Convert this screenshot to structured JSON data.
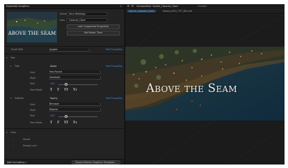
{
  "left_panel": {
    "tab_title": "Essential Graphics",
    "master": {
      "name_label": "Name",
      "name_value": "Intro Redesign",
      "solo_label": "Solo",
      "solo_value": "Capsule_Open",
      "lock_button": "Lock Supported Properties",
      "set_poster_button": "Set Poster Time",
      "thumbnail_text": "ABOVE THE SEAM"
    },
    "group_font": {
      "label": "Drvef SDK",
      "value": "Angled",
      "edit_link": "Edit Properties"
    },
    "text_section": {
      "header": "Text",
      "title_label": "Title",
      "title_value": "Abbie",
      "title_edit": "Edit Properties",
      "font_label": "Font",
      "font_value": "Hoo Round",
      "style_label": "Style",
      "style_value": "Semibold",
      "size_label": "Size",
      "size_value": "100",
      "facebold_label": "Face Mode",
      "subtitle_label": "Subtitle",
      "subtitle_value": "Sporty",
      "subtitle_edit": "Edit Properties",
      "font2_value": "Baroque",
      "style2_value": "Regular",
      "size2_value": "100",
      "faux_glyphs": [
        "T",
        "T",
        "TT",
        "Tт"
      ]
    },
    "color_section": {
      "header": "Color",
      "item1": "Shield",
      "item2": "Design Lock"
    },
    "bottom": {
      "add_formatting": "Add Formatting",
      "export_button": "Export Motion Graphics Template..."
    }
  },
  "right_panel": {
    "tabs": [
      "Composition: Sports_Capsule_Open",
      "Console"
    ],
    "sub_tabs": [
      "Sports_Capsule_Open",
      "Adobe_MSG_TXT_Blurred"
    ],
    "title_overlay": "Above the Seam"
  },
  "colors": {
    "accent": "#3f8fe0",
    "panel": "#232323",
    "background": "#1d1d1d"
  }
}
